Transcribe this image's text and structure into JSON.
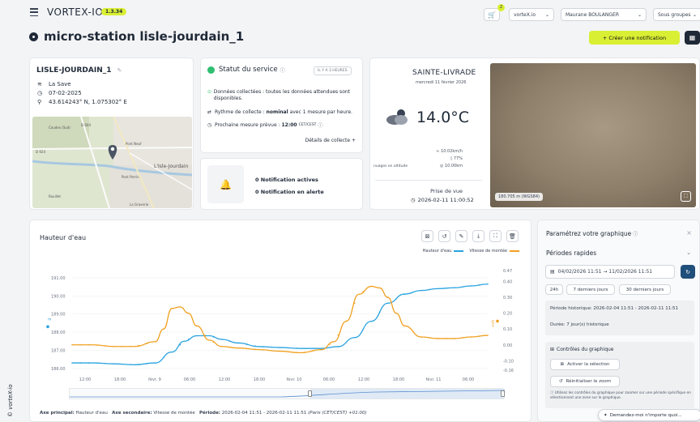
{
  "header": {
    "logo": "VORTEX-IO",
    "version": "1.3.34",
    "cart_badge": "2",
    "org": "vorteX.io",
    "user": "Maurane BOULANGER",
    "groups": "Sous groupes"
  },
  "page": {
    "title": "micro-station lisle-jourdain_1",
    "create_notif": "+ Créer une notification"
  },
  "station": {
    "name": "LISLE-JOURDAIN_1",
    "river": "La Save",
    "date": "07-02-2025",
    "coords": "43.614243° N, 1.075302° E",
    "map_labels": [
      "D 604",
      "Pont Neuf",
      "L'Isle-Jourdain",
      "D 924",
      "Pont Perrin",
      "La Graverie",
      "Rouillet",
      "Coudes (Sud)"
    ]
  },
  "service": {
    "title": "Statut du service",
    "badge": "IL Y A 3 HEURES",
    "line1": "Données collectées : toutes les données attendues sont disponibles.",
    "line2_pre": "Rythme de collecte : ",
    "line2_bold": "nominal",
    "line2_post": " avec 1 mesure par heure.",
    "line3_pre": "Prochaine mesure prévue : ",
    "line3_bold": "12:00",
    "line3_tz": "CET/CEST",
    "details": "Détails de collecte +"
  },
  "notifications": {
    "active": "0 Notification actives",
    "alert": "0 Notification en alerte"
  },
  "weather": {
    "city": "SAINTE-LIVRADE",
    "date": "mercredi 11 février 2026",
    "temp": "14.0°C",
    "wind": "10.02km/h",
    "humidity": "77%",
    "visibility": "10.00km",
    "cloud_label": "nuages en altitude"
  },
  "photo": {
    "label": "Prise de vue",
    "datetime": "2026-02-11 11:00:52",
    "altitude": "180.705 m (WGS84)"
  },
  "chart_panel": {
    "title": "Hauteur d'eau",
    "legend1": "Hauteur d'eau",
    "legend2": "Vitesse de montée",
    "footer_axis1_label": "Axe principal:",
    "footer_axis1": "Hauteur d'eau",
    "footer_axis2_label": "Axe secondaire:",
    "footer_axis2": "Vitesse de montée",
    "footer_period_label": "Période:",
    "footer_period": "2026-02-04 11:51 - 2026-02-11 11:51",
    "footer_tz": "(Paris (CET/CEST) +01:00)"
  },
  "side": {
    "title": "Paramétrez votre graphique",
    "quick": "Périodes rapides",
    "range": "04/02/2026 11:51 → 11/02/2026 11:51",
    "btns": [
      "24h",
      "7 derniers jours",
      "30 derniers jours"
    ],
    "hist": "Période historique: 2026-02-04 11:51 - 2026-02-11 11:51",
    "duree": "Durée: 7 jour(s) historique",
    "controls": "Contrôles du graphique",
    "activate": "Activer la sélection",
    "reset": "Réinitialiser le zoom",
    "hint": "Utilisez les contrôles du graphique pour zoomer sur une période spécifique en sélectionnant une zone sur le graphique.",
    "ask": "Demandez-moi n'importe quoi..."
  },
  "watermark": "© vorteX-io",
  "chart_data": {
    "type": "line",
    "x_ticks": [
      "12:00",
      "18:00",
      "févr. 9",
      "06:00",
      "12:00",
      "18:00",
      "févr. 10",
      "06:00",
      "12:00",
      "18:00",
      "févr. 11",
      "06:00"
    ],
    "y_left": [
      191.0,
      190.0,
      189.0,
      188.0,
      187.0,
      186.0
    ],
    "y_right": [
      0.47,
      0.4,
      0.3,
      0.2,
      0.1,
      0.0,
      -0.1,
      -0.16
    ],
    "y_left_label": "m",
    "y_right_label": "m/h",
    "series": [
      {
        "name": "Hauteur d'eau",
        "axis": "left",
        "color": "#29a3e0",
        "t": [
          0,
          5,
          10,
          15,
          20,
          24,
          27,
          30,
          33,
          36,
          40,
          45,
          50,
          55,
          60,
          64,
          68,
          72,
          76,
          80,
          84,
          88,
          92,
          96,
          100
        ],
        "v": [
          186.3,
          186.3,
          186.25,
          186.2,
          186.3,
          186.9,
          187.5,
          187.8,
          187.8,
          187.6,
          187.4,
          187.2,
          187.15,
          187.1,
          187.1,
          187.2,
          187.7,
          188.6,
          189.6,
          190.1,
          190.3,
          190.4,
          190.45,
          190.55,
          190.65
        ]
      },
      {
        "name": "Vitesse de montée",
        "axis": "right",
        "color": "#f0a020",
        "t": [
          0,
          5,
          10,
          15,
          20,
          22,
          24,
          26,
          28,
          30,
          33,
          36,
          40,
          45,
          50,
          55,
          60,
          63,
          66,
          69,
          72,
          74,
          76,
          78,
          80,
          84,
          88,
          92,
          96,
          100
        ],
        "v": [
          0.0,
          0.0,
          -0.01,
          -0.01,
          0.02,
          0.1,
          0.23,
          0.24,
          0.2,
          0.12,
          0.03,
          -0.01,
          -0.02,
          -0.03,
          -0.04,
          -0.05,
          -0.03,
          0.02,
          0.15,
          0.32,
          0.37,
          0.36,
          0.3,
          0.2,
          0.12,
          0.05,
          0.04,
          0.04,
          0.05,
          0.06
        ]
      }
    ]
  }
}
